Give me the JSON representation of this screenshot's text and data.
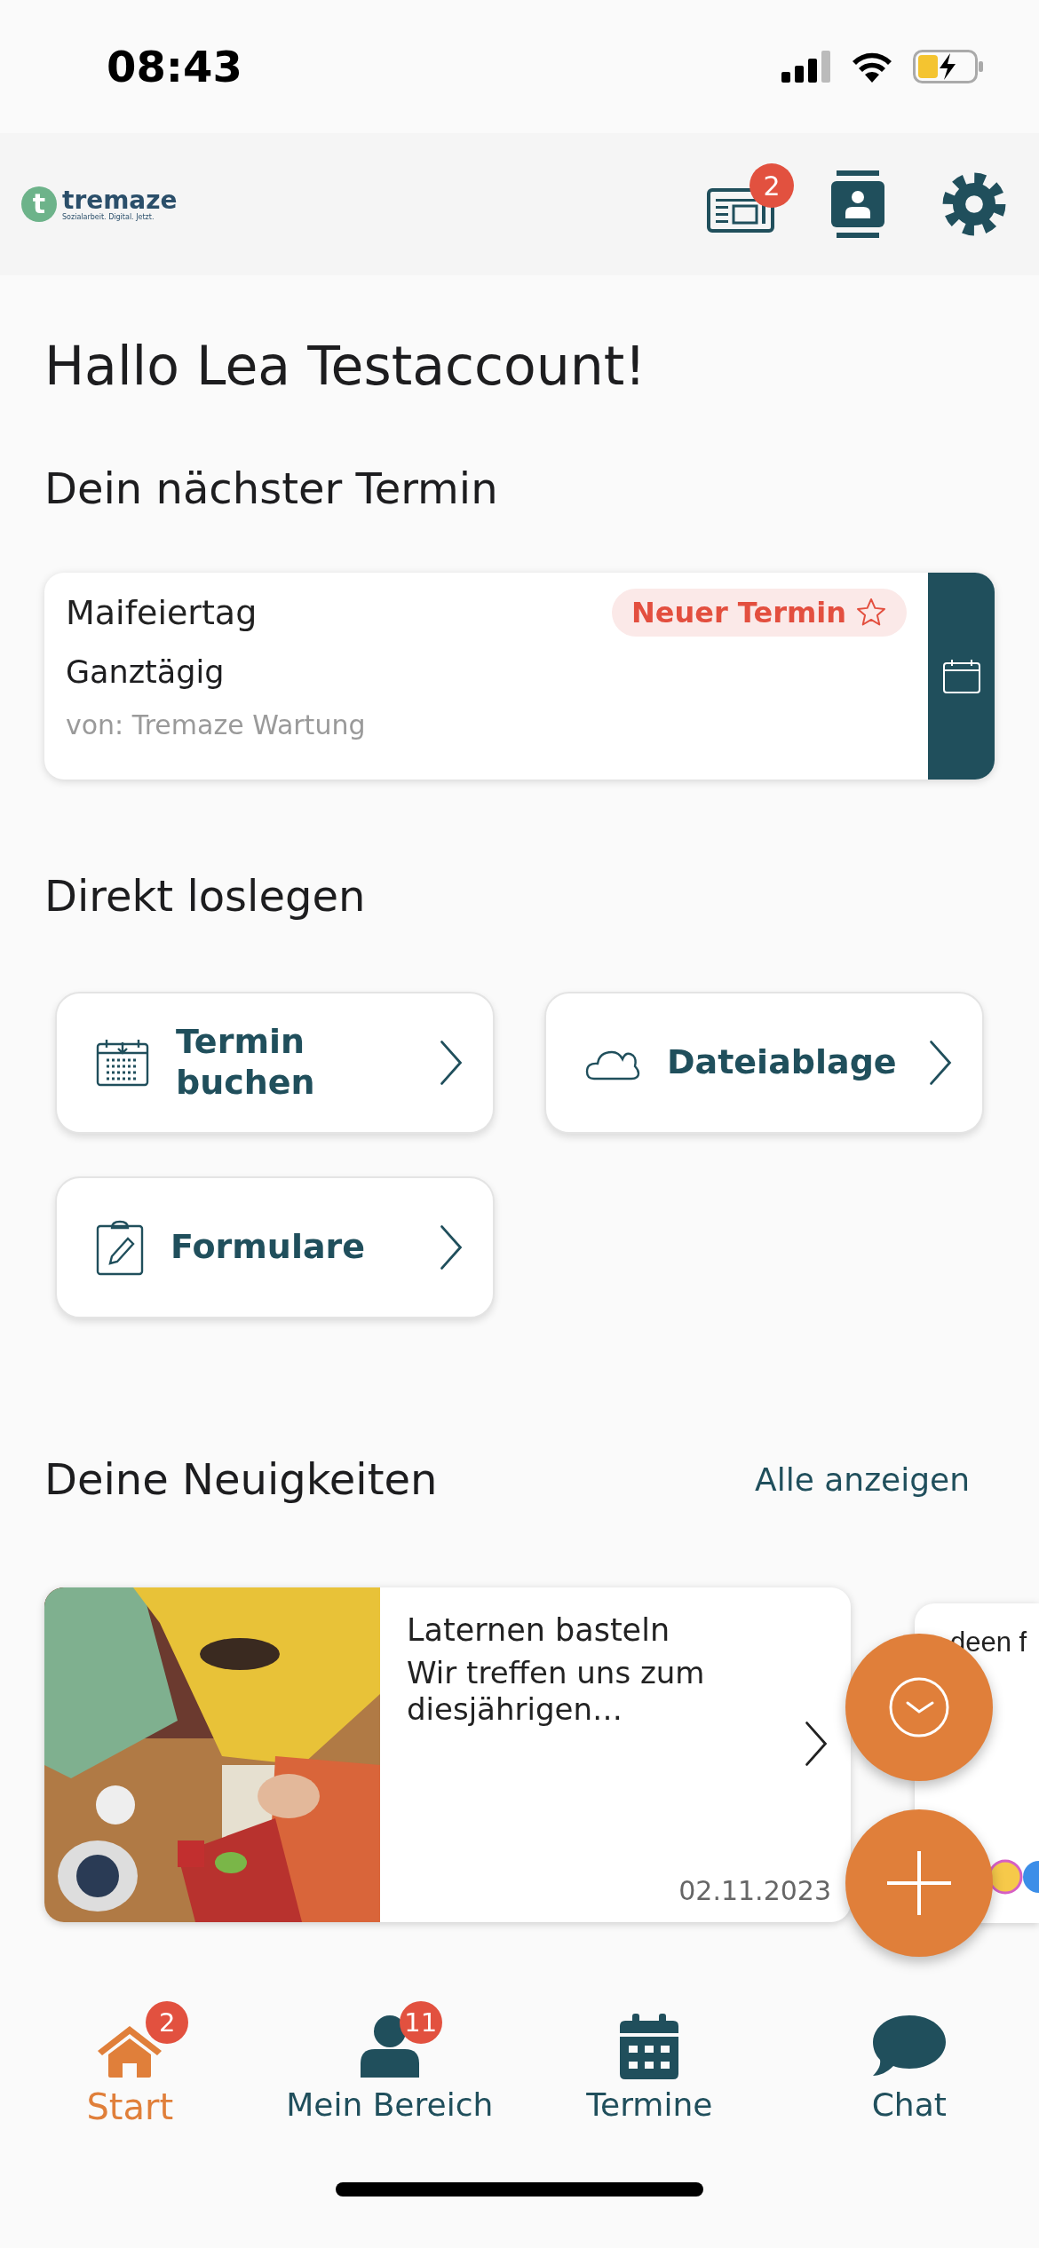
{
  "status_bar": {
    "time": "08:43"
  },
  "header": {
    "logo": {
      "mark": "t",
      "name": "tremaze",
      "tagline": "Sozialarbeit. Digital. Jetzt."
    },
    "news_badge": "2"
  },
  "greeting": "Hallo Lea Testaccount!",
  "next_appointment": {
    "heading": "Dein nächster Termin",
    "title": "Maifeiertag",
    "badge": "Neuer Termin",
    "time": "Ganztägig",
    "author": "von: Tremaze Wartung"
  },
  "quick_actions": {
    "heading": "Direkt loslegen",
    "items": [
      {
        "kind": "calendar",
        "label": "Termin buchen"
      },
      {
        "kind": "cloud",
        "label": "Dateiablage"
      },
      {
        "kind": "form",
        "label": "Formulare"
      }
    ]
  },
  "news": {
    "heading": "Deine Neuigkeiten",
    "show_all": "Alle anzeigen",
    "items": [
      {
        "kind": "picture",
        "title": "Laternen basteln",
        "excerpt": "Wir treffen uns zum diesjährigen…",
        "date": "02.11.2023"
      },
      {
        "kind": "partial",
        "title": "deen f"
      }
    ]
  },
  "tabs": [
    {
      "kind": "home",
      "label": "Start",
      "badge": "2",
      "selected": true
    },
    {
      "kind": "person",
      "label": "Mein Bereich",
      "badge": "11",
      "selected": false
    },
    {
      "kind": "calendar",
      "label": "Termine",
      "selected": false
    },
    {
      "kind": "chat",
      "label": "Chat",
      "selected": false
    }
  ]
}
